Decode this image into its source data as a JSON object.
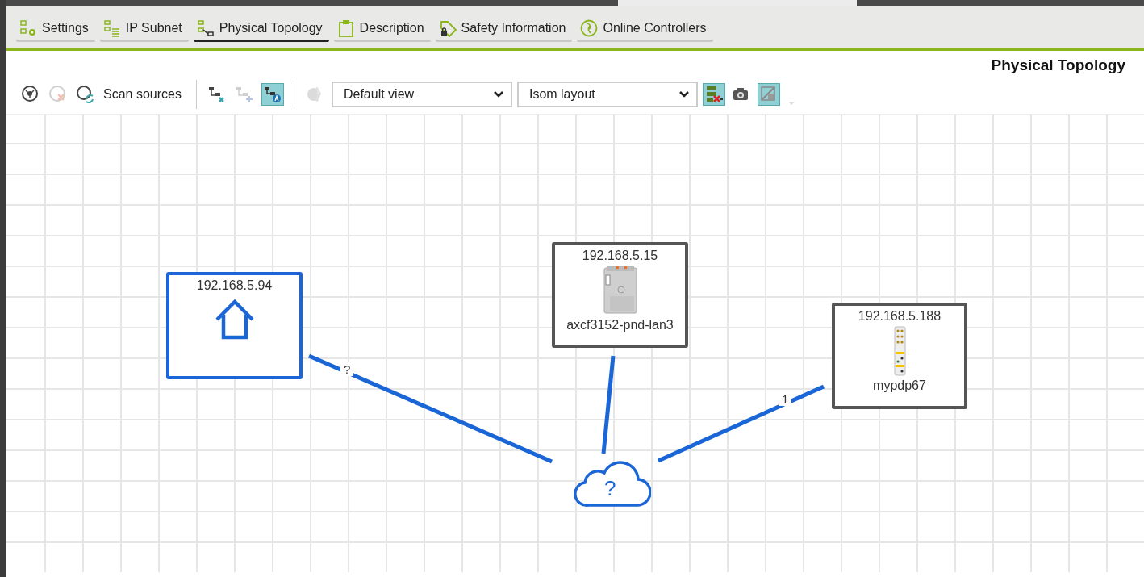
{
  "tabs": [
    {
      "label": "Settings",
      "selected": false
    },
    {
      "label": "IP Subnet",
      "selected": false
    },
    {
      "label": "Physical Topology",
      "selected": true
    },
    {
      "label": "Description",
      "selected": false
    },
    {
      "label": "Safety Information",
      "selected": false
    },
    {
      "label": "Online Controllers",
      "selected": false
    }
  ],
  "title": "Physical Topology",
  "toolbar": [
    {
      "kind": "icon",
      "disabled": false,
      "on": false
    },
    {
      "kind": "icon",
      "disabled": true,
      "on": false
    },
    {
      "kind": "icon",
      "disabled": false,
      "on": false
    },
    {
      "kind": "text",
      "label": "Scan sources"
    },
    {
      "kind": "separator"
    },
    {
      "kind": "icon",
      "disabled": false,
      "on": false
    },
    {
      "kind": "icon",
      "disabled": true,
      "on": false
    },
    {
      "kind": "icon",
      "disabled": false,
      "on": true
    },
    {
      "kind": "separator"
    },
    {
      "kind": "icon",
      "disabled": true,
      "on": false
    },
    {
      "kind": "dropdown",
      "value": "Default view"
    },
    {
      "kind": "dropdown",
      "value": "Isom layout"
    },
    {
      "kind": "icon",
      "disabled": false,
      "on": true
    },
    {
      "kind": "icon",
      "disabled": false,
      "on": false
    },
    {
      "kind": "icon",
      "disabled": false,
      "on": true
    },
    {
      "kind": "icon",
      "disabled": true,
      "on": false
    }
  ],
  "nodes": [
    {
      "kind": "home",
      "ip": "192.168.5.94",
      "selected": true,
      "port_label": "?"
    },
    {
      "kind": "device",
      "ip": "192.168.5.15",
      "name": "axcf3152-pnd-lan3",
      "selected": false
    },
    {
      "kind": "device",
      "ip": "192.168.5.188",
      "name": "mypdp67",
      "selected": false,
      "port_label": "1"
    },
    {
      "kind": "cloud",
      "label": "?"
    }
  ]
}
